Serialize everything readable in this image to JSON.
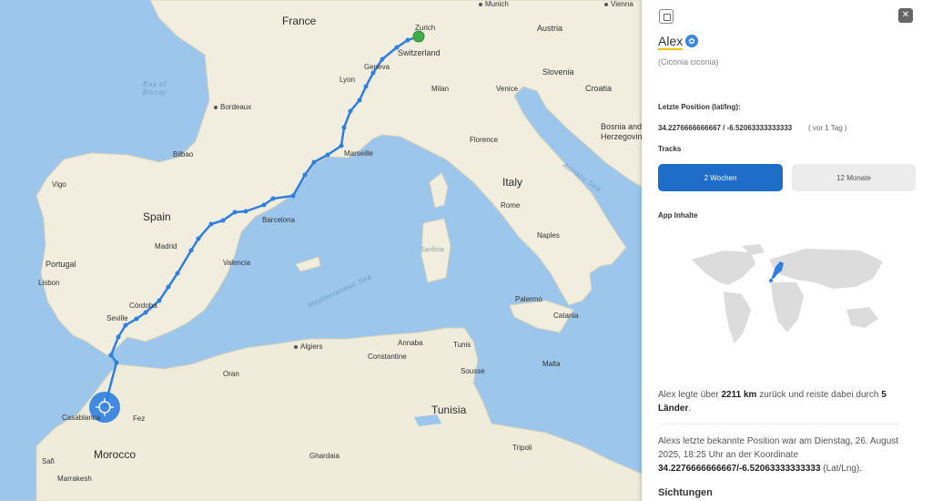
{
  "map": {
    "countries": [
      "France",
      "Switzerland",
      "Austria",
      "Slovenia",
      "Croatia",
      "Bosnia and Herzegovina",
      "Italy",
      "Spain",
      "Portugal",
      "Morocco",
      "Tunisia"
    ],
    "cities": [
      "Munich",
      "Vienna",
      "Zurich",
      "Geneva",
      "Lyon",
      "Milan",
      "Venice",
      "Bordeaux",
      "Marseille",
      "Florence",
      "Bilbao",
      "Barcelona",
      "Rome",
      "Vigo",
      "Madrid",
      "Naples",
      "Valencia",
      "Lisbon",
      "Córdoba",
      "Seville",
      "Palermo",
      "Catania",
      "Algiers",
      "Annaba",
      "Tunis",
      "Constantine",
      "Sousse",
      "Oran",
      "Malta",
      "Casablanca",
      "Fez",
      "Ghardaia",
      "Tripoli",
      "Safi",
      "Marrakesh",
      "Sardinia"
    ],
    "seas": [
      "Bay of Biscay",
      "Mediterranean Sea",
      "Adriatic Sea"
    ],
    "route_color": "#2e7fe0",
    "start_color": "#3fae49"
  },
  "panel": {
    "name": "Alex",
    "species": "(Ciconia ciconia)",
    "last_position_label": "Letzte Position (lat/lng):",
    "last_position_value": "34.2276666666667 / -6.52063333333333",
    "last_position_age": "( vor 1 Tag )",
    "tracks_label": "Tracks",
    "track_options": [
      "2 Wochen",
      "12 Monate"
    ],
    "selected_track": "2 Wochen",
    "app_content_label": "App Inhalte",
    "stats_prefix": "Alex legte über",
    "distance": "2211 km",
    "stats_middle": "zurück und reiste dabei durch",
    "countries_count": "5 Länder",
    "stats_suffix": ".",
    "last_known_prefix": "Alexs letzte bekannte Position war am Dienstag, 26. August 2025, 18:25 Uhr an der Koordinate",
    "last_known_coords": "34.2276666666667/-6.52063333333333",
    "last_known_suffix": "(Lat/Lng).",
    "sightings_label": "Sichtungen",
    "accent": "#1d6dc9",
    "badge_color": "#3a86e0"
  }
}
